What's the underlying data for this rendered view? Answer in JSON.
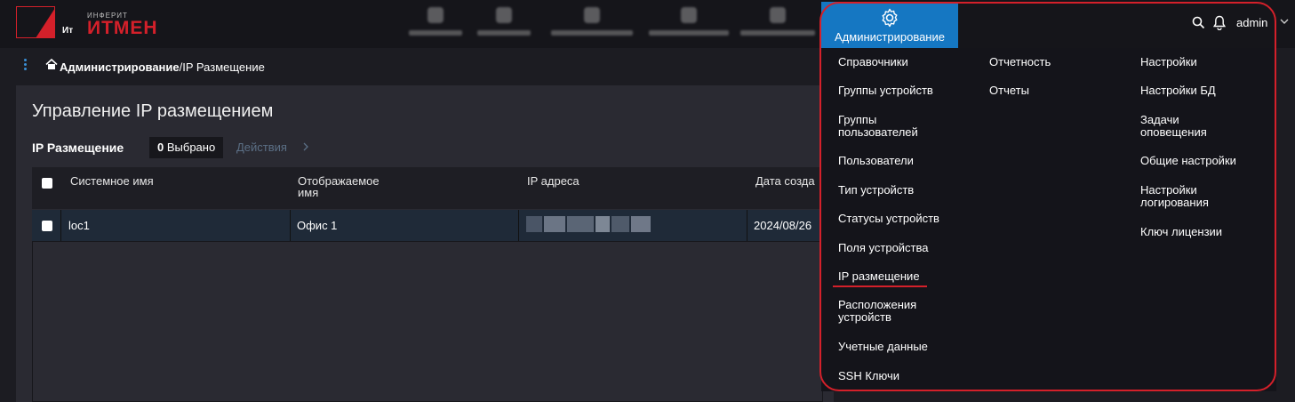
{
  "brand": {
    "mark": "Ит",
    "subtitle": "ИНФЕРИТ",
    "name": "ИТМЕН",
    "color": "#d4202a"
  },
  "header": {
    "active_tab": "Администрирование",
    "user": "admin",
    "accent": "#1577c2"
  },
  "breadcrumb": {
    "root": "Администрирование",
    "current": "/IP Размещение"
  },
  "page": {
    "title": "Управление IP размещением",
    "section": "IP Размещение",
    "selected_count": "0",
    "selected_label": "Выбрано",
    "actions": "Действия"
  },
  "table": {
    "columns": [
      "Системное имя",
      "Отображаемое",
      "имя",
      "IP адреса",
      "Дата созда"
    ],
    "rows": [
      {
        "system_name": "loc1",
        "display_name": "Офис 1",
        "date": "2024/08/26"
      }
    ]
  },
  "menu": {
    "col1": [
      "Справочники",
      "Группы устройств",
      "Группы",
      "пользователей",
      "Пользователи",
      "Тип устройств",
      "Статусы устройств",
      "Поля устройства",
      "IP размещение",
      "Расположения",
      "устройств",
      "Учетные данные",
      "SSH Ключи"
    ],
    "col2": [
      "Отчетность",
      "Отчеты"
    ],
    "col3": [
      "Настройки",
      "Настройки БД",
      "Задачи",
      "оповещения",
      "Общие настройки",
      "Настройки",
      "логирования",
      "Ключ лицензии"
    ]
  }
}
